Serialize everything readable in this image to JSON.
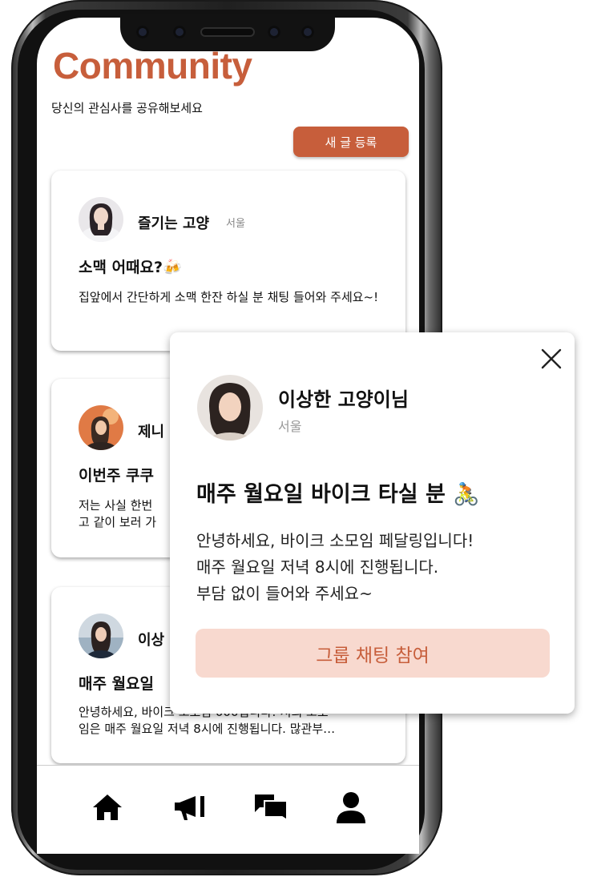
{
  "header": {
    "title": "Community",
    "subtitle": "당신의 관심사를 공유해보세요",
    "new_post_label": "새 글 등록"
  },
  "posts": [
    {
      "name": "즐기는 고양",
      "location": "서울",
      "title": "소맥 어때요?🍻",
      "body": "집앞에서 간단하게 소맥 한잔 하실 분 채팅 들어와 주세요~!"
    },
    {
      "name": "제니",
      "location": "",
      "title": "이번주 쿠쿠",
      "body": "저는 사실 한번\n고 같이 보러 가"
    },
    {
      "name": "이상",
      "location": "",
      "title": "매주 월요일",
      "body": "안녕하세요, 바이크 소모임 000입니다! 저희 소모\n임은 매주 월요일 저녁 8시에 진행됩니다. 많관부…"
    }
  ],
  "bottom_nav": {
    "items": [
      {
        "icon": "home-icon"
      },
      {
        "icon": "megaphone-icon"
      },
      {
        "icon": "chat-icon"
      },
      {
        "icon": "user-icon"
      }
    ]
  },
  "modal": {
    "name": "이상한 고양이님",
    "location": "서울",
    "title": "매주 월요일 바이크 타실 분 🚴",
    "body": "안녕하세요, 바이크 소모임 페달링입니다!\n매주 월요일 저녁 8시에 진행됩니다.\n부담 없이 들어와 주세요~",
    "join_label": "그룹 채팅 참여"
  },
  "colors": {
    "accent": "#c75e3b",
    "join_bg": "#f8d9cf"
  }
}
